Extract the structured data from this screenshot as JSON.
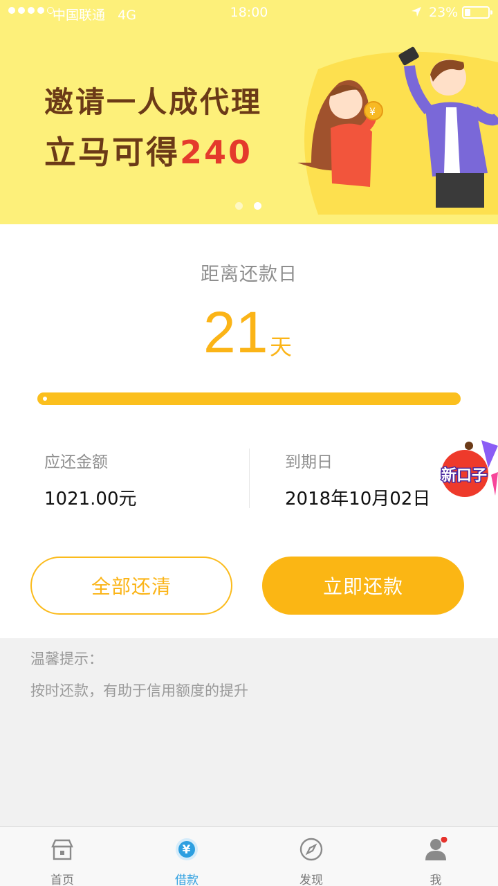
{
  "status_bar": {
    "carrier": "中国联通",
    "network": "4G",
    "time": "18:00",
    "battery": "23%"
  },
  "banner": {
    "line1": "邀请一人成代理",
    "line2_prefix": "立马可得",
    "line2_highlight": "240",
    "carousel_pages": 2,
    "active_page": 2
  },
  "repayment": {
    "countdown_label": "距离还款日",
    "days": "21",
    "days_unit": "天",
    "amount_label": "应还金额",
    "amount_value": "1021.00元",
    "due_label": "到期日",
    "due_value": "2018年10月02日",
    "sticker_text": "新口子",
    "progress_fraction": 0.02
  },
  "actions": {
    "repay_all": "全部还清",
    "repay_now": "立即还款"
  },
  "tips": {
    "title": "温馨提示：",
    "body": "按时还款，有助于信用额度的提升"
  },
  "tabbar": {
    "items": [
      {
        "label": "首页",
        "icon": "home-icon"
      },
      {
        "label": "借款",
        "icon": "yen-icon"
      },
      {
        "label": "发现",
        "icon": "compass-icon"
      },
      {
        "label": "我",
        "icon": "user-icon"
      }
    ],
    "active_index": 1
  },
  "colors": {
    "accent": "#fbb417",
    "banner_bg": "#fdf07a",
    "tab_active": "#2d9fe0",
    "badge": "#e6322c"
  }
}
